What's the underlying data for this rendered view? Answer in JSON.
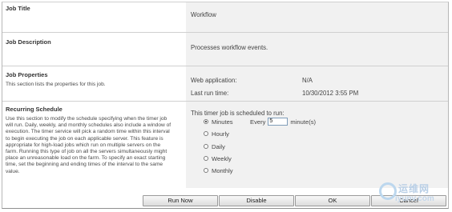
{
  "sections": {
    "job_title": {
      "label": "Job Title",
      "value": "Workflow"
    },
    "job_description": {
      "label": "Job Description",
      "value": "Processes workflow events."
    },
    "job_properties": {
      "label": "Job Properties",
      "description": "This section lists the properties for this job.",
      "web_app_label": "Web application:",
      "web_app_value": "N/A",
      "last_run_label": "Last run time:",
      "last_run_value": "10/30/2012 3:55 PM"
    },
    "recurring": {
      "label": "Recurring Schedule",
      "description_lines": [
        "Use this section to modify the schedule specifying when the timer job",
        "will run. Daily, weekly, and monthly schedules also include a window of",
        "execution. The timer service will pick a random time within this interval",
        "to begin executing the job on each applicable server. This feature is",
        "appropriate for high-load jobs which run on multiple servers on the",
        "farm. Running this type of job on all the servers simultaneously might",
        "place an unreasonable load on the farm. To specify an exact starting",
        "time, set the beginning and ending times of the interval to the same",
        "value."
      ],
      "prompt": "This timer job is scheduled to run:",
      "options": [
        "Minutes",
        "Hourly",
        "Daily",
        "Weekly",
        "Monthly"
      ],
      "selected": "Minutes",
      "every_label": "Every",
      "every_value": "5",
      "minutes_label": "minute(s)"
    }
  },
  "buttons": {
    "run_now": "Run Now",
    "disable": "Disable",
    "ok": "OK",
    "cancel": "Cancel"
  },
  "watermark": {
    "cn": "运维网",
    "en": "iyunv.com"
  }
}
